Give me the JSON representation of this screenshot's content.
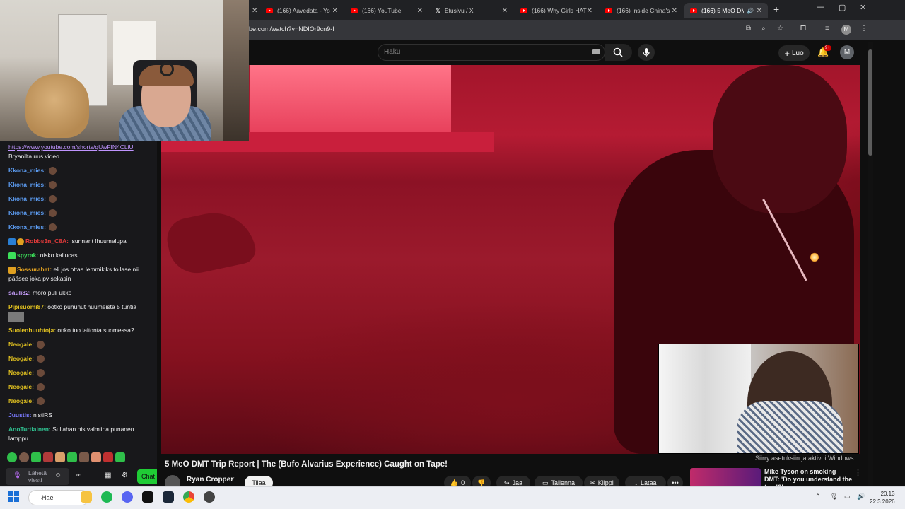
{
  "browser": {
    "tabs": [
      {
        "title": "(166) Aavedata - Yo",
        "icon": "youtube-icon"
      },
      {
        "title": "(166) YouTube",
        "icon": "youtube-icon"
      },
      {
        "title": "Etusivu / X",
        "icon": "x-logo-icon"
      },
      {
        "title": "(166) Why Girls HAT",
        "icon": "youtube-icon"
      },
      {
        "title": "(166) Inside China's",
        "icon": "youtube-icon"
      },
      {
        "title": "(166) 5 MeO DM",
        "icon": "youtube-icon",
        "active": true
      }
    ],
    "url": "be.com/watch?v=NDIOr9cn9-I",
    "profile_initial": "M"
  },
  "youtube": {
    "search_placeholder": "Haku",
    "create_label": "Luo",
    "notification_count": "9+",
    "avatar_initial": "M",
    "video": {
      "title": "5 MeO DMT Trip Report | The (Bufo Alvarius Experience) Caught on Tape!",
      "channel": "Ryan Cropper",
      "subscribe_label": "Tilaa",
      "like_count": "0",
      "share_label": "Jaa",
      "save_label": "Tallenna",
      "clip_label": "Klippi",
      "download_label": "Lataa",
      "more_label": "•••"
    },
    "recommendation": {
      "title": "Mike Tyson on smoking DMT: 'Do you understand the toad?' ..."
    },
    "overlay_text": "Siirry asetuksiin ja aktivoi Windows."
  },
  "chat": {
    "lines": [
      {
        "user": "",
        "text": "https://www.youtube.com/shorts/qUwFIN4CLiU",
        "color": "#bf94ff",
        "link": true
      },
      {
        "user": "",
        "text": "Bryanilta uus video",
        "color": "#efeff1"
      },
      {
        "user": "Kkona_mies:",
        "text": "",
        "color": "#5c9cf2",
        "emote": true
      },
      {
        "user": "Kkona_mies:",
        "text": "",
        "color": "#5c9cf2",
        "emote": true
      },
      {
        "user": "Kkona_mies:",
        "text": "",
        "color": "#5c9cf2",
        "emote": true
      },
      {
        "user": "Kkona_mies:",
        "text": "",
        "color": "#5c9cf2",
        "emote": true
      },
      {
        "user": "Kkona_mies:",
        "text": "",
        "color": "#5c9cf2",
        "emote": true
      },
      {
        "user": "Robbs3n_C8A:",
        "text": " !sunnarit !huumelupa",
        "color": "#e23a3a"
      },
      {
        "user": "spyrak:",
        "text": " oisko kallucast",
        "color": "#3ce05a"
      },
      {
        "user": "Sossurahat:",
        "text": " eli jos ottaa lemmikiks tollase nii pääsee joka pv sekasin",
        "color": "#e0a020"
      },
      {
        "user": "sauli82:",
        "text": " moro puli ukko",
        "color": "#c9a0ff"
      },
      {
        "user": "Pipisuomi87:",
        "text": " ootko puhunut huumeista 5 tuntia",
        "color": "#e0c020"
      },
      {
        "user": "Suolenhuuhtoja:",
        "text": " onko tuo laitonta suomessa?",
        "color": "#e0c020"
      },
      {
        "user": "Neogale:",
        "text": "",
        "color": "#e0c020",
        "emote": true
      },
      {
        "user": "Neogale:",
        "text": "",
        "color": "#e0c020",
        "emote": true
      },
      {
        "user": "Neogale:",
        "text": "",
        "color": "#e0c020",
        "emote": true
      },
      {
        "user": "Neogale:",
        "text": "",
        "color": "#e0c020",
        "emote": true
      },
      {
        "user": "Neogale:",
        "text": "",
        "color": "#e0c020",
        "emote": true
      },
      {
        "user": "Juustis:",
        "text": " nistiRS",
        "color": "#7a7aff"
      },
      {
        "user": "AnoTurtiainen:",
        "text": " Sullahan ois valmiina punanen lamppu",
        "color": "#2fbf8f"
      }
    ],
    "input_placeholder": "Lähetä viesti",
    "send_label": "Chat"
  },
  "taskbar": {
    "search_label": "Hae",
    "time": "20.13",
    "date": "22.3.2026"
  }
}
